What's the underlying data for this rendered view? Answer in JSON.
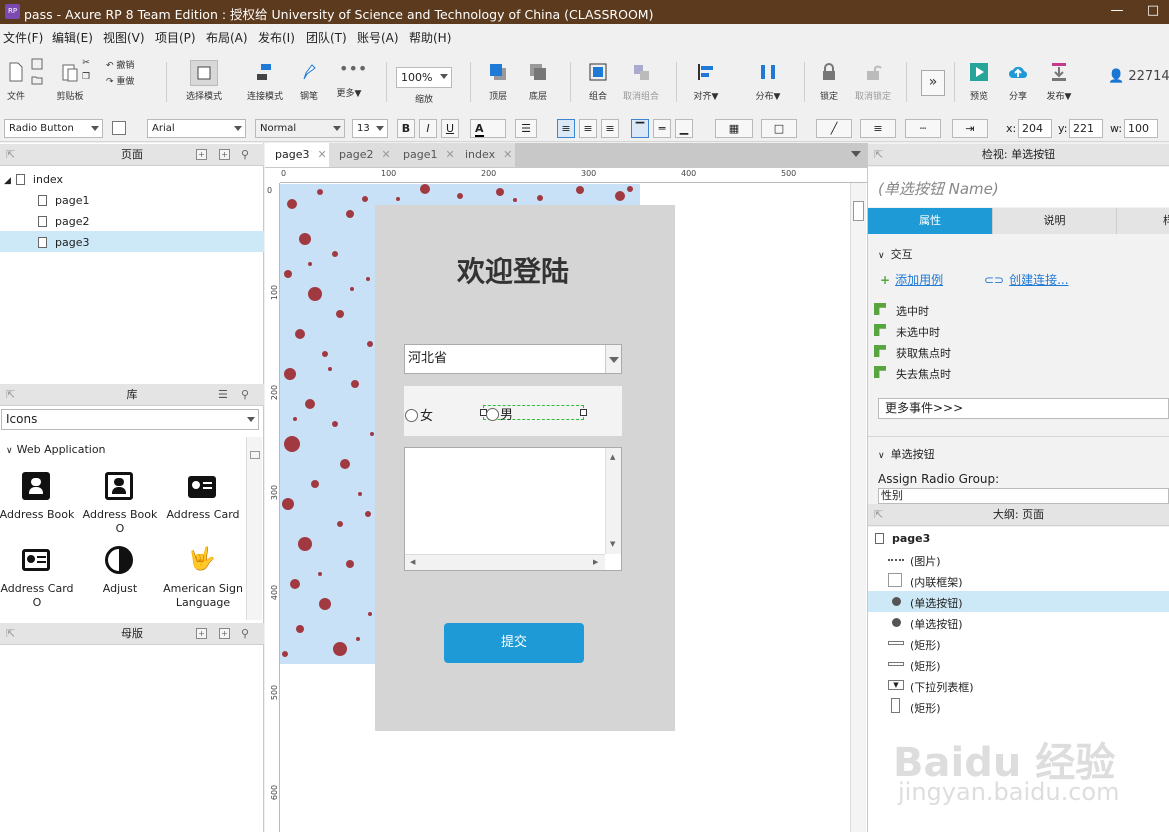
{
  "window": {
    "title": "pass - Axure RP 8 Team Edition : 授权给 University of Science and Technology of China (CLASSROOM)",
    "icon_text": "RP"
  },
  "menu": [
    "文件(F)",
    "编辑(E)",
    "视图(V)",
    "项目(P)",
    "布局(A)",
    "发布(I)",
    "团队(T)",
    "账号(A)",
    "帮助(H)"
  ],
  "toolbar": {
    "file": "文件",
    "clipboard": "剪贴板",
    "undo": "撤销",
    "redo": "重做",
    "select_mode": "选择模式",
    "connect_mode": "连接模式",
    "pen": "钢笔",
    "more": "更多▼",
    "zoom": "100%",
    "zoom_label": "缩放",
    "top": "顶层",
    "bottom": "底层",
    "group": "组合",
    "ungroup": "取消组合",
    "align": "对齐▼",
    "distribute": "分布▼",
    "lock": "锁定",
    "unlock": "取消锁定",
    "preview": "预览",
    "share": "分享",
    "publish": "发布▼",
    "user": "22714"
  },
  "format": {
    "widget_type": "Radio Button",
    "font": "Arial",
    "style": "Normal",
    "size": "13",
    "bold": "B",
    "italic": "I",
    "underline": "U",
    "color": "A",
    "x_label": "x:",
    "x": "204",
    "y_label": "y:",
    "y": "221",
    "w_label": "w:",
    "w": "100"
  },
  "pages": {
    "header": "页面",
    "root": "index",
    "items": [
      "page1",
      "page2",
      "page3"
    ]
  },
  "library": {
    "header": "库",
    "selected": "Icons",
    "group": "Web Application",
    "icons": [
      {
        "label": "Address Book",
        "name": "address-book-icon"
      },
      {
        "label": "Address Book O",
        "name": "address-book-outline-icon"
      },
      {
        "label": "Address Card",
        "name": "address-card-icon"
      },
      {
        "label": "Address Card O",
        "name": "address-card-outline-icon"
      },
      {
        "label": "Adjust",
        "name": "adjust-icon"
      },
      {
        "label": "American Sign Language",
        "name": "sign-language-icon"
      }
    ]
  },
  "masters": {
    "header": "母版"
  },
  "tabs": [
    "page3",
    "page2",
    "page1",
    "index"
  ],
  "ruler": {
    "h": [
      "0",
      "100",
      "200",
      "300",
      "400",
      "500"
    ],
    "v": [
      "0",
      "100",
      "200",
      "300",
      "400",
      "500",
      "600"
    ]
  },
  "login": {
    "title": "欢迎登陆",
    "province": "河北省",
    "radio_female": "女",
    "radio_male": "男",
    "submit": "提交"
  },
  "inspector": {
    "header": "检视: 单选按钮",
    "name_placeholder": "(单选按钮 Name)",
    "tabs": [
      "属性",
      "说明",
      "样"
    ],
    "interaction": "交互",
    "add_case": "添加用例",
    "create_link": "创建连接...",
    "events": [
      "选中时",
      "未选中时",
      "获取焦点时",
      "失去焦点时"
    ],
    "more_events": "更多事件>>>",
    "radio_section": "单选按钮",
    "assign_group": "Assign Radio Group:",
    "group_value": "性别"
  },
  "outline": {
    "header": "大纲: 页面",
    "page": "page3",
    "items": [
      "(图片)",
      "(内联框架)",
      "(单选按钮)",
      "(单选按钮)",
      "(矩形)",
      "(矩形)",
      "(下拉列表框)",
      "(矩形)"
    ]
  },
  "watermark": {
    "text": "Baidu 经验",
    "url": "jingyan.baidu.com"
  },
  "colors": {
    "titlebar": "#5b3a1e",
    "accent": "#1e9ad6",
    "selection": "#cde8f6"
  }
}
